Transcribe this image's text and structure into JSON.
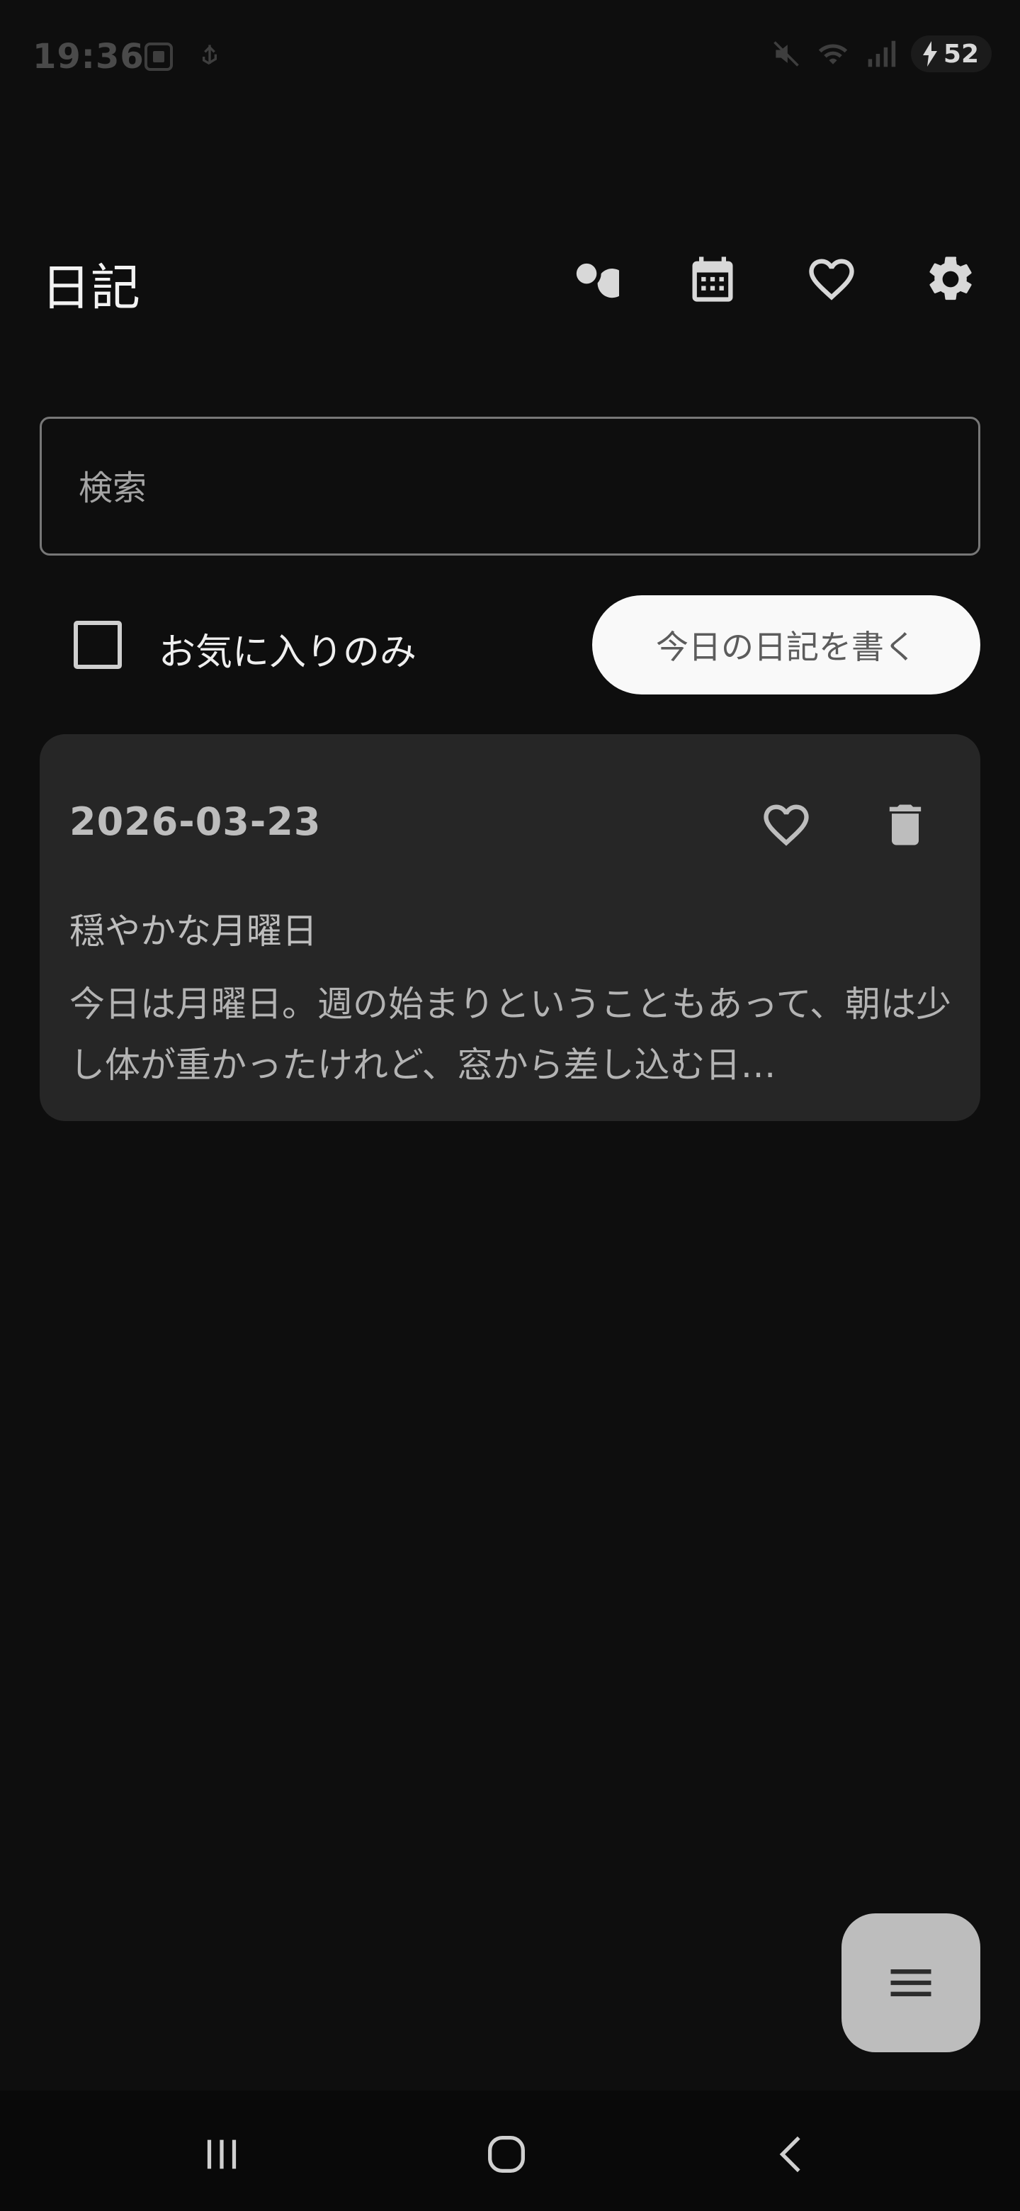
{
  "status_bar": {
    "time": "19:36",
    "battery": "52"
  },
  "header": {
    "title": "日記",
    "icons": [
      "search-icon",
      "calendar-icon",
      "heart-icon",
      "gear-icon"
    ]
  },
  "search": {
    "placeholder": "検索",
    "value": ""
  },
  "filter": {
    "favorites_only_label": "お気に入りのみ",
    "favorites_only_checked": false,
    "write_today_label": "今日の日記を書く"
  },
  "entries": [
    {
      "date": "2026-03-23",
      "title": "穏やかな月曜日",
      "body": "今日は月曜日。週の始まりということもあって、朝は少し体が重かったけれど、窓から差し込む日…",
      "favorite": false
    }
  ],
  "fab": {
    "icon": "menu-icon"
  },
  "nav": {
    "icons": [
      "recents-icon",
      "home-icon",
      "back-icon"
    ]
  },
  "colors": {
    "background": "#0e0e0e",
    "card": "#262626",
    "button": "#f9f9f9",
    "fab": "#bdbdbd"
  }
}
